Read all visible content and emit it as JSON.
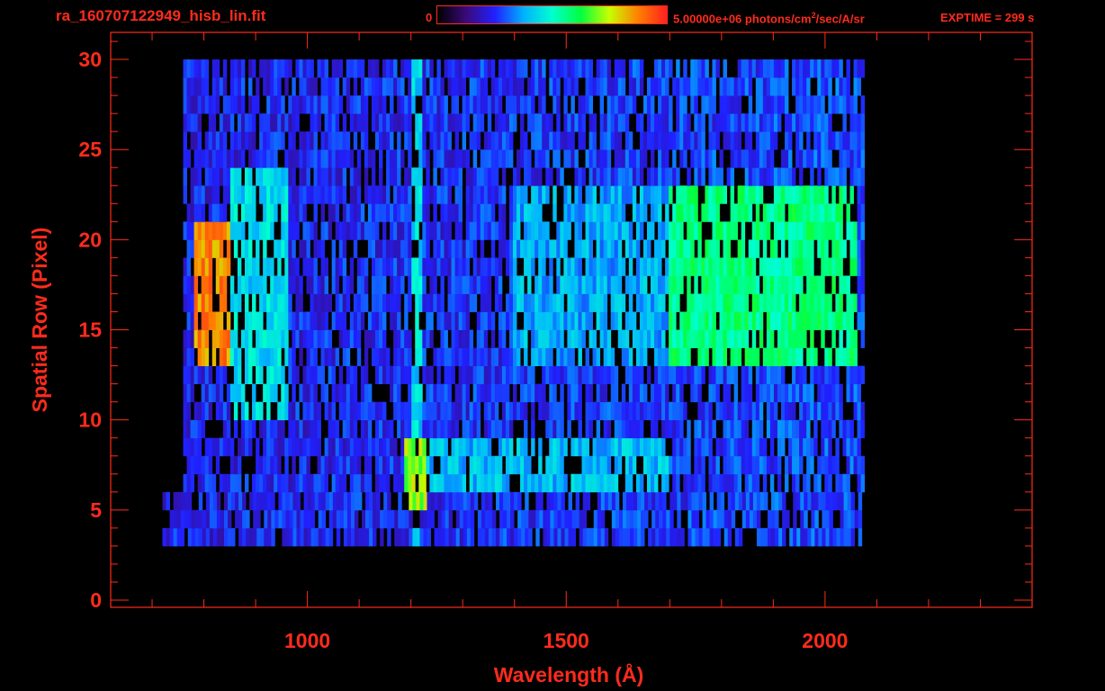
{
  "header": {
    "filename": "ra_160707122949_hisb_lin.fit",
    "colorbar_min_label": "0",
    "colorbar_max_label_base": "5.00000e+06 photons/cm",
    "colorbar_max_label_sup": "2",
    "colorbar_max_label_tail": "/sec/A/sr",
    "exptime_label": "EXPTIME = 299 s"
  },
  "colors": {
    "axis": "#ff2b1c",
    "background": "#000000",
    "colormap": [
      "#000000",
      "#3a0a78",
      "#2020ff",
      "#00b0ff",
      "#00ffd0",
      "#00ff40",
      "#c8ff00",
      "#ff8000",
      "#ff2020"
    ]
  },
  "chart_data": {
    "type": "heatmap",
    "title": "",
    "xlabel": "Wavelength (Å)",
    "ylabel": "Spatial Row (Pixel)",
    "xlim": [
      620,
      2400
    ],
    "ylim": [
      -0.4,
      31.5
    ],
    "x_ticks": [
      1000,
      1500,
      2000
    ],
    "y_ticks": [
      0,
      5,
      10,
      15,
      20,
      25,
      30
    ],
    "x_tick_labels": [
      "1000",
      "1500",
      "2000"
    ],
    "y_tick_labels": [
      "0",
      "5",
      "10",
      "15",
      "20",
      "25",
      "30"
    ],
    "x_data_range": [
      770,
      2070
    ],
    "y_data_range": [
      3,
      30
    ],
    "colorbar_range": [
      0,
      5000000
    ],
    "features": [
      {
        "name": "",
        "x_range": [
          780,
          850
        ],
        "y_range": [
          13,
          21
        ],
        "level": 0.85
      },
      {
        "name": "",
        "x_range": [
          1190,
          1230
        ],
        "y_range": [
          5,
          9
        ],
        "level": 0.7
      },
      {
        "name": "",
        "x_range": [
          1700,
          2060
        ],
        "y_range": [
          13,
          23
        ],
        "level": 0.55
      }
    ]
  }
}
